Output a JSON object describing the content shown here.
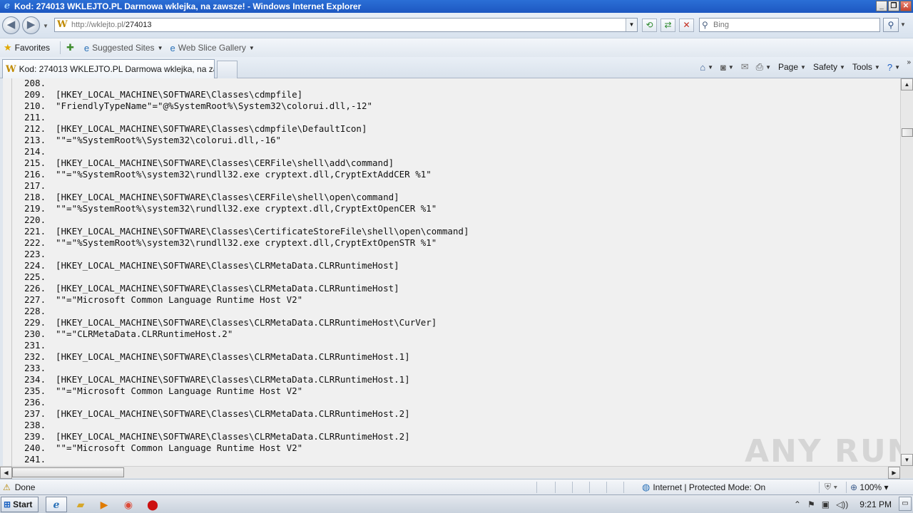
{
  "window": {
    "title": "Kod: 274013 WKLEJTO.PL Darmowa wklejka, na zawsze! - Windows Internet Explorer"
  },
  "address_bar": {
    "url_host": "http://wklejto.pl/",
    "url_path": "274013"
  },
  "search": {
    "placeholder": "Bing"
  },
  "favorites_bar": {
    "favorites_label": "Favorites",
    "suggested_sites_label": "Suggested Sites",
    "web_slice_gallery_label": "Web Slice Gallery"
  },
  "tabs": [
    {
      "label": "Kod: 274013 WKLEJTO.PL Darmowa wklejka, na zaws..."
    }
  ],
  "command_bar": {
    "page_label": "Page",
    "safety_label": "Safety",
    "tools_label": "Tools"
  },
  "code_lines": [
    {
      "num": "208.",
      "text": ""
    },
    {
      "num": "209.",
      "text": "[HKEY_LOCAL_MACHINE\\SOFTWARE\\Classes\\cdmpfile]"
    },
    {
      "num": "210.",
      "text": "\"FriendlyTypeName\"=\"@%SystemRoot%\\System32\\colorui.dll,-12\""
    },
    {
      "num": "211.",
      "text": ""
    },
    {
      "num": "212.",
      "text": "[HKEY_LOCAL_MACHINE\\SOFTWARE\\Classes\\cdmpfile\\DefaultIcon]"
    },
    {
      "num": "213.",
      "text": "\"\"=\"%SystemRoot%\\System32\\colorui.dll,-16\""
    },
    {
      "num": "214.",
      "text": ""
    },
    {
      "num": "215.",
      "text": "[HKEY_LOCAL_MACHINE\\SOFTWARE\\Classes\\CERFile\\shell\\add\\command]"
    },
    {
      "num": "216.",
      "text": "\"\"=\"%SystemRoot%\\system32\\rundll32.exe cryptext.dll,CryptExtAddCER %1\""
    },
    {
      "num": "217.",
      "text": ""
    },
    {
      "num": "218.",
      "text": "[HKEY_LOCAL_MACHINE\\SOFTWARE\\Classes\\CERFile\\shell\\open\\command]"
    },
    {
      "num": "219.",
      "text": "\"\"=\"%SystemRoot%\\system32\\rundll32.exe cryptext.dll,CryptExtOpenCER %1\""
    },
    {
      "num": "220.",
      "text": ""
    },
    {
      "num": "221.",
      "text": "[HKEY_LOCAL_MACHINE\\SOFTWARE\\Classes\\CertificateStoreFile\\shell\\open\\command]"
    },
    {
      "num": "222.",
      "text": "\"\"=\"%SystemRoot%\\system32\\rundll32.exe cryptext.dll,CryptExtOpenSTR %1\""
    },
    {
      "num": "223.",
      "text": ""
    },
    {
      "num": "224.",
      "text": "[HKEY_LOCAL_MACHINE\\SOFTWARE\\Classes\\CLRMetaData.CLRRuntimeHost]"
    },
    {
      "num": "225.",
      "text": ""
    },
    {
      "num": "226.",
      "text": "[HKEY_LOCAL_MACHINE\\SOFTWARE\\Classes\\CLRMetaData.CLRRuntimeHost]"
    },
    {
      "num": "227.",
      "text": "\"\"=\"Microsoft Common Language Runtime Host V2\""
    },
    {
      "num": "228.",
      "text": ""
    },
    {
      "num": "229.",
      "text": "[HKEY_LOCAL_MACHINE\\SOFTWARE\\Classes\\CLRMetaData.CLRRuntimeHost\\CurVer]"
    },
    {
      "num": "230.",
      "text": "\"\"=\"CLRMetaData.CLRRuntimeHost.2\""
    },
    {
      "num": "231.",
      "text": ""
    },
    {
      "num": "232.",
      "text": "[HKEY_LOCAL_MACHINE\\SOFTWARE\\Classes\\CLRMetaData.CLRRuntimeHost.1]"
    },
    {
      "num": "233.",
      "text": ""
    },
    {
      "num": "234.",
      "text": "[HKEY_LOCAL_MACHINE\\SOFTWARE\\Classes\\CLRMetaData.CLRRuntimeHost.1]"
    },
    {
      "num": "235.",
      "text": "\"\"=\"Microsoft Common Language Runtime Host V2\""
    },
    {
      "num": "236.",
      "text": ""
    },
    {
      "num": "237.",
      "text": "[HKEY_LOCAL_MACHINE\\SOFTWARE\\Classes\\CLRMetaData.CLRRuntimeHost.2]"
    },
    {
      "num": "238.",
      "text": ""
    },
    {
      "num": "239.",
      "text": "[HKEY_LOCAL_MACHINE\\SOFTWARE\\Classes\\CLRMetaData.CLRRuntimeHost.2]"
    },
    {
      "num": "240.",
      "text": "\"\"=\"Microsoft Common Language Runtime Host V2\""
    },
    {
      "num": "241.",
      "text": ""
    }
  ],
  "watermark": "ANY RUN",
  "status_bar": {
    "status_text": "Done",
    "zone_text": "Internet | Protected Mode: On",
    "zoom_text": "100%"
  },
  "taskbar": {
    "start_label": "Start",
    "clock": "9:21 PM"
  },
  "icons": {
    "back": "back-arrow-icon",
    "forward": "forward-arrow-icon",
    "ie": "internet-explorer-icon",
    "favicon": "wklejto-favicon",
    "home": "home-icon",
    "feeds": "rss-feed-icon",
    "mail": "mail-icon",
    "print": "printer-icon",
    "help": "help-icon"
  },
  "colors": {
    "titlebar": "#1d57c1",
    "content_bg": "#f0f0f0"
  }
}
